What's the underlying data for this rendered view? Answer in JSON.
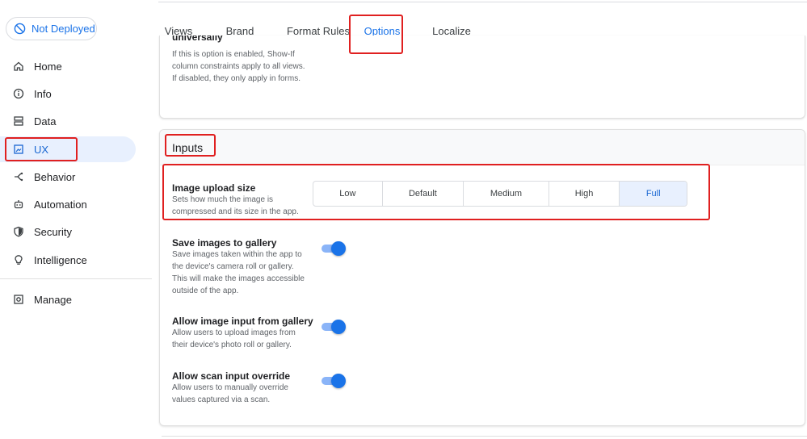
{
  "deploy_status": "Not Deployed",
  "sidebar": {
    "items": [
      {
        "label": "Home",
        "icon": "home-icon"
      },
      {
        "label": "Info",
        "icon": "info-icon"
      },
      {
        "label": "Data",
        "icon": "database-icon"
      },
      {
        "label": "UX",
        "icon": "image-icon",
        "active": true
      },
      {
        "label": "Behavior",
        "icon": "branch-icon"
      },
      {
        "label": "Automation",
        "icon": "robot-icon"
      },
      {
        "label": "Security",
        "icon": "shield-icon"
      },
      {
        "label": "Intelligence",
        "icon": "lightbulb-icon"
      }
    ],
    "manage": {
      "label": "Manage",
      "icon": "manage-icon"
    }
  },
  "tabs": [
    {
      "label": "Views"
    },
    {
      "label": "Brand"
    },
    {
      "label": "Format Rules"
    },
    {
      "label": "Options",
      "active": true
    },
    {
      "label": "Localize"
    }
  ],
  "top_card": {
    "cut_title": "universally",
    "desc": "If this is option is enabled, Show-If column constraints apply to all views. If disabled, they only apply in forms."
  },
  "inputs_card": {
    "title": "Inputs",
    "image_upload": {
      "title": "Image upload size",
      "desc": "Sets how much the image is compressed and its size in the app.",
      "options": [
        "Low",
        "Default",
        "Medium",
        "High",
        "Full"
      ],
      "selected": "Full"
    },
    "save_gallery": {
      "title": "Save images to gallery",
      "desc": "Save images taken within the app to the device's camera roll or gallery. This will make the images accessible outside of the app.",
      "on": true
    },
    "allow_gallery": {
      "title": "Allow image input from gallery",
      "desc": "Allow users to upload images from their device's photo roll or gallery.",
      "on": true
    },
    "scan_override": {
      "title": "Allow scan input override",
      "desc": "Allow users to manually override values captured via a scan.",
      "on": true
    }
  },
  "colors": {
    "accent": "#1a73e8",
    "highlight": "#e02020",
    "active_bg": "#e8f0fe"
  }
}
